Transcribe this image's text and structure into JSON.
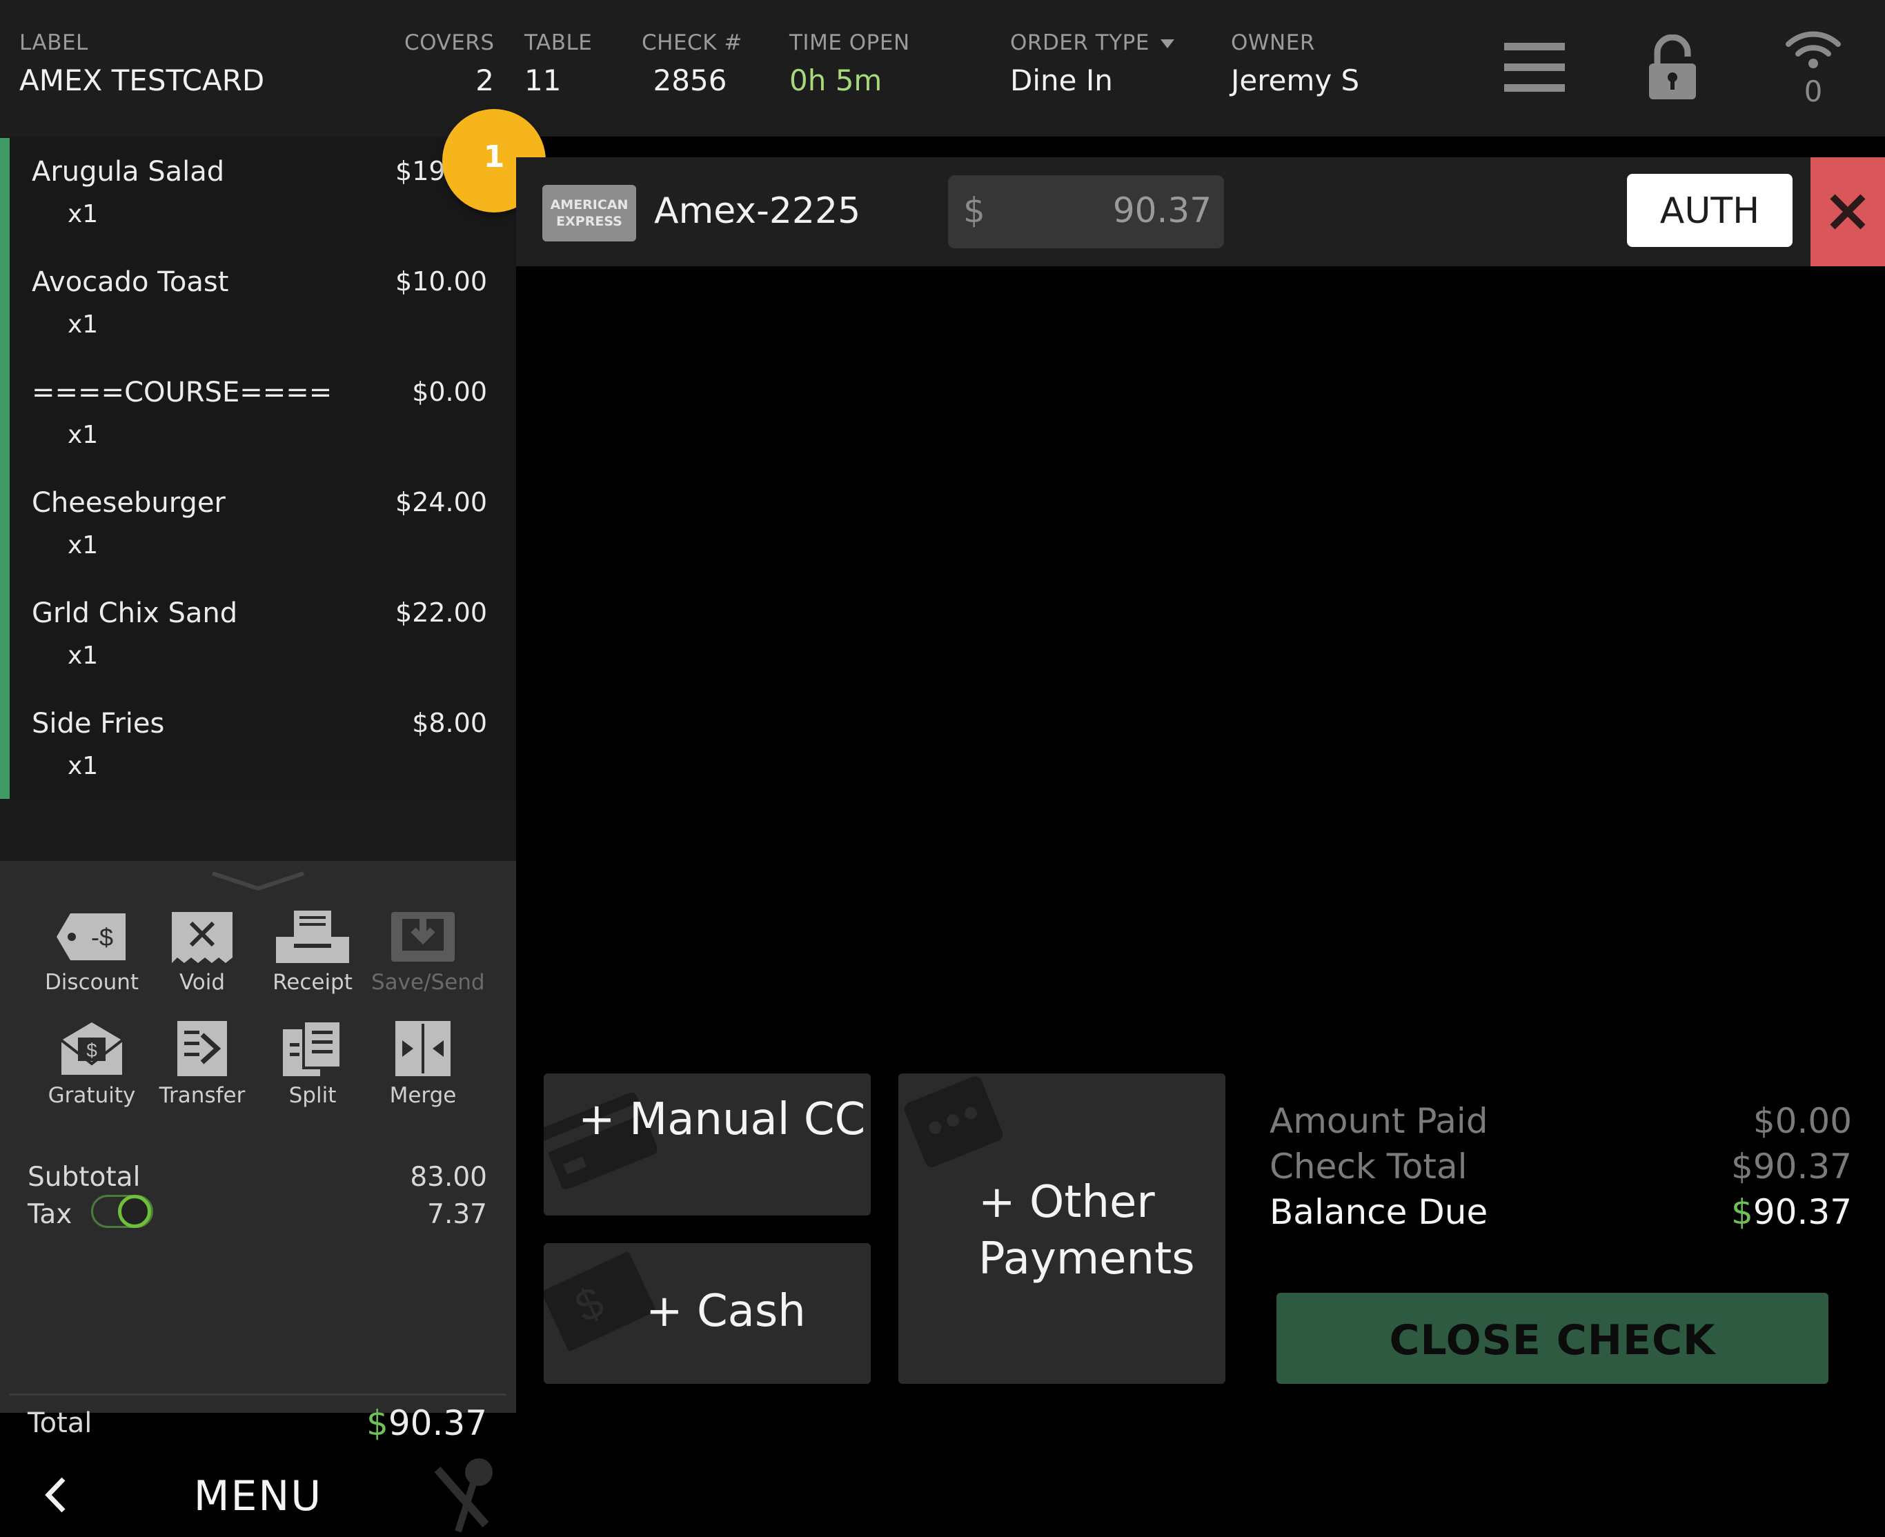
{
  "header": {
    "label_title": "LABEL",
    "label_value": "AMEX TESTCARD",
    "covers_title": "COVERS",
    "covers_value": "2",
    "table_title": "TABLE",
    "table_value": "11",
    "check_title": "CHECK #",
    "check_value": "2856",
    "time_title": "TIME OPEN",
    "time_value": "0h 5m",
    "order_type_title": "ORDER TYPE",
    "order_type_value": "Dine In",
    "owner_title": "OWNER",
    "owner_value": "Jeremy S",
    "wifi_count": "0",
    "icons": [
      "hamburger-menu-icon",
      "lock-icon",
      "wifi-icon"
    ]
  },
  "items": [
    {
      "name": "Arugula Salad",
      "price": "$19.00",
      "qty": "x1"
    },
    {
      "name": "Avocado Toast",
      "price": "$10.00",
      "qty": "x1"
    },
    {
      "name": "====COURSE====",
      "price": "$0.00",
      "qty": "x1"
    },
    {
      "name": "Cheeseburger",
      "price": "$24.00",
      "qty": "x1"
    },
    {
      "name": "Grld Chix Sand",
      "price": "$22.00",
      "qty": "x1"
    },
    {
      "name": "Side Fries",
      "price": "$8.00",
      "qty": "x1"
    }
  ],
  "badge": "1",
  "tools": {
    "discount": "Discount",
    "void": "Void",
    "receipt": "Receipt",
    "save_send": "Save/Send",
    "gratuity": "Gratuity",
    "transfer": "Transfer",
    "split": "Split",
    "merge": "Merge"
  },
  "totals": {
    "subtotal_label": "Subtotal",
    "subtotal_value": "83.00",
    "tax_label": "Tax",
    "tax_value": "7.37",
    "tax_enabled": true,
    "total_label": "Total",
    "total_currency": "$",
    "total_value": "90.37"
  },
  "menu": {
    "label": "MENU"
  },
  "payment": {
    "logo_line1": "AMERICAN",
    "logo_line2": "EXPRESS",
    "card_name": "Amex-2225",
    "currency": "$",
    "amount": "90.37",
    "auth_label": "AUTH"
  },
  "buttons": {
    "manual_cc": "+ Manual CC",
    "cash": "+ Cash",
    "other_line1": "+ Other",
    "other_line2": "Payments"
  },
  "summary": {
    "amount_paid_label": "Amount Paid",
    "amount_paid_value": "$0.00",
    "check_total_label": "Check Total",
    "check_total_value": "$90.37",
    "balance_due_label": "Balance Due",
    "balance_due_currency": "$",
    "balance_due_value": "90.37",
    "close_check_label": "CLOSE CHECK"
  },
  "colors": {
    "accent_green": "#3f9b63",
    "badge_yellow": "#f6b51a",
    "close_red": "#d9575b",
    "close_check_green": "#2e5a42",
    "time_green": "#a5d97c"
  }
}
